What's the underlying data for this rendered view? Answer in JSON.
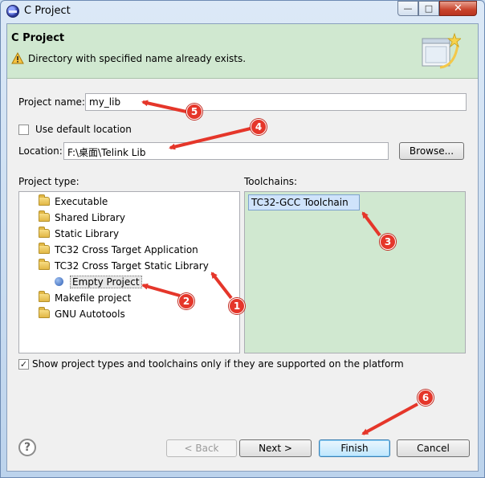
{
  "window": {
    "title": "C Project",
    "min_glyph": "—",
    "max_glyph": "□",
    "close_glyph": "✕"
  },
  "banner": {
    "title": "C Project",
    "message": "Directory with specified name already exists."
  },
  "form": {
    "project_name_label": "Project name:",
    "project_name_value": "my_lib",
    "use_default_location_label": "Use default location",
    "use_default_location_checked": false,
    "location_label": "Location:",
    "location_value": "F:\\桌面\\Telink Lib",
    "browse_label": "Browse..."
  },
  "project_type": {
    "label": "Project type:",
    "items": [
      {
        "label": "Executable",
        "icon": "folder-icon"
      },
      {
        "label": "Shared Library",
        "icon": "folder-icon"
      },
      {
        "label": "Static Library",
        "icon": "folder-icon"
      },
      {
        "label": "TC32 Cross Target Application",
        "icon": "folder-icon"
      },
      {
        "label": "TC32 Cross Target Static Library",
        "icon": "folder-icon"
      },
      {
        "label": "Empty Project",
        "icon": "project-dot-icon",
        "selected": true
      },
      {
        "label": "Makefile project",
        "icon": "folder-icon"
      },
      {
        "label": "GNU Autotools",
        "icon": "folder-icon"
      }
    ]
  },
  "toolchains": {
    "label": "Toolchains:",
    "items": [
      {
        "label": "TC32-GCC Toolchain",
        "selected": true
      }
    ]
  },
  "filter": {
    "label": "Show project types and toolchains only if they are supported on the platform",
    "checked": true,
    "check_glyph": "✓"
  },
  "buttons": {
    "help_glyph": "?",
    "back": "< Back",
    "next": "Next >",
    "finish": "Finish",
    "cancel": "Cancel"
  },
  "annotations": [
    "1",
    "2",
    "3",
    "4",
    "5",
    "6"
  ],
  "colors": {
    "banner_bg": "#d0e8d0",
    "toolchain_panel_bg": "#d0e8d0",
    "annotation_red": "#e5362a"
  }
}
